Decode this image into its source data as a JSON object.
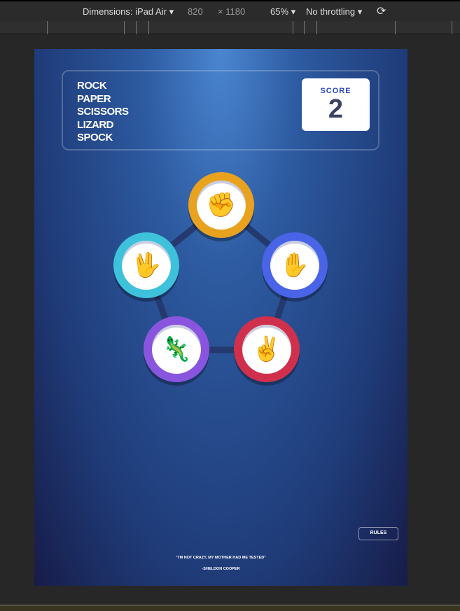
{
  "devtools": {
    "device_label": "Dimensions: iPad Air",
    "width": "820",
    "height": "1180",
    "zoom": "65%",
    "throttling": "No throttling",
    "rotate_icon": "rotate-icon"
  },
  "game": {
    "title_lines": [
      "ROCK",
      "PAPER",
      "SCISSORS",
      "LIZARD",
      "SPOCK"
    ],
    "score_label": "SCORE",
    "score_value": "2",
    "choices": [
      {
        "name": "rock",
        "icon": "✊",
        "color": "#e9a21e"
      },
      {
        "name": "paper",
        "icon": "✋",
        "color": "#4a64e8"
      },
      {
        "name": "scissors",
        "icon": "✌",
        "color": "#d0304c"
      },
      {
        "name": "lizard",
        "icon": "🦎",
        "color": "#8a55de"
      },
      {
        "name": "spock",
        "icon": "🖖",
        "color": "#3ec2dc"
      }
    ],
    "rules_label": "RULES",
    "quote": "\"I'M NOT CRAZY, MY MOTHER HAD ME TESTED\"",
    "quote_author": "-SHELDON COOPER"
  }
}
